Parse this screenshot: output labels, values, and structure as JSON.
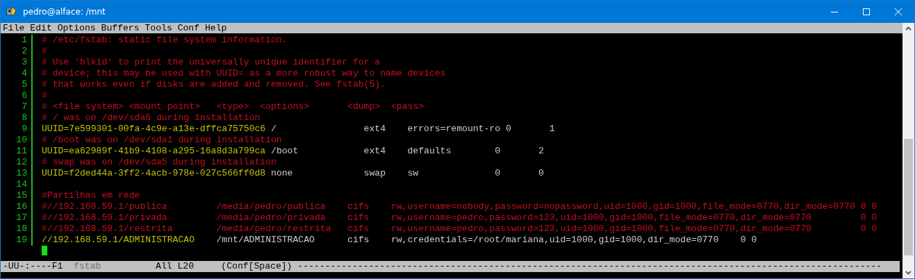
{
  "window": {
    "title": "pedro@alface: /mnt"
  },
  "menu": [
    "File",
    "Edit",
    "Options",
    "Buffers",
    "Tools",
    "Conf",
    "Help"
  ],
  "lines": [
    {
      "number": "1",
      "segments": [
        {
          "kind": "comment",
          "text": "# /etc/fstab: static file system information."
        }
      ]
    },
    {
      "number": "2",
      "segments": [
        {
          "kind": "comment",
          "text": "#"
        }
      ]
    },
    {
      "number": "3",
      "segments": [
        {
          "kind": "comment",
          "text": "# Use 'blkid' to print the universally unique identifier for a"
        }
      ]
    },
    {
      "number": "4",
      "segments": [
        {
          "kind": "comment",
          "text": "# device; this may be used with UUID= as a more robust way to name devices"
        }
      ]
    },
    {
      "number": "5",
      "segments": [
        {
          "kind": "comment",
          "text": "# that works even if disks are added and removed. See fstab(5)."
        }
      ]
    },
    {
      "number": "6",
      "segments": [
        {
          "kind": "comment",
          "text": "#"
        }
      ]
    },
    {
      "number": "7",
      "segments": [
        {
          "kind": "comment",
          "text": "# <file system> <mount point>   <type>  <options>       <dump>  <pass>"
        }
      ]
    },
    {
      "number": "8",
      "segments": [
        {
          "kind": "comment",
          "text": "# / was on /dev/sda6 during installation"
        }
      ]
    },
    {
      "number": "9",
      "segments": [
        {
          "kind": "device",
          "text": "UUID=7e599301-00fa-4c9e-a13e-dffca75750c6"
        },
        {
          "kind": "plain",
          "text": " /                ext4    errors=remount-ro 0       1"
        }
      ]
    },
    {
      "number": "10",
      "segments": [
        {
          "kind": "comment",
          "text": "# /boot was on /dev/sda1 during installation"
        }
      ]
    },
    {
      "number": "11",
      "segments": [
        {
          "kind": "device",
          "text": "UUID=ea62989f-41b9-4108-a295-16a8d3a799ca"
        },
        {
          "kind": "plain",
          "text": " /boot            ext4    defaults        0       2"
        }
      ]
    },
    {
      "number": "12",
      "segments": [
        {
          "kind": "comment",
          "text": "# swap was on /dev/sda5 during installation"
        }
      ]
    },
    {
      "number": "13",
      "segments": [
        {
          "kind": "device",
          "text": "UUID=f2ded44a-3ff2-4acb-978e-027c566ff0d8"
        },
        {
          "kind": "plain",
          "text": " none             swap    sw              0       0"
        }
      ]
    },
    {
      "number": "14"
    },
    {
      "number": "15",
      "segments": [
        {
          "kind": "comment",
          "text": "#Partilhas em rede"
        }
      ]
    },
    {
      "number": "16",
      "segments": [
        {
          "kind": "comment",
          "text": "#//192.168.59.1/publica         /media/pedro/publica    cifs    rw,username=nobody,password=nopassword,uid=1000,gid=1000,file_mode=0770,dir_mode=0770 0 0"
        }
      ]
    },
    {
      "number": "17",
      "segments": [
        {
          "kind": "comment",
          "text": "#//192.168.59.1/privada         /media/pedro/privada    cifs    rw,username=pedro,password=123,uid=1000,gid=1000,file_mode=0770,dir_mode=0770         0 0"
        }
      ]
    },
    {
      "number": "18",
      "segments": [
        {
          "kind": "comment",
          "text": "#//192.168.59.1/restrita        /media/pedro/restrita   cifs    rw,username=pedro,password=123,uid=1000,gid=1000,file_mode=0770,dir_mode=0770         0 0"
        }
      ]
    },
    {
      "number": "19",
      "segments": [
        {
          "kind": "device",
          "text": "//192.168.59.1/ADMINISTRACAO"
        },
        {
          "kind": "plain",
          "text": "    /mnt/ADMINISTRACAO      cifs    rw,credentials=/root/mariana,uid=1000,gid=1000,dir_mode=0770    0 0"
        }
      ]
    }
  ],
  "mode_line": [
    {
      "kind": "plain",
      "text": "-UU-:----F1  "
    },
    {
      "kind": "buffer",
      "text": "fstab"
    },
    {
      "kind": "plain",
      "text": "          All L20     (Conf[Space]) -----------------------------------------------------------------------------------------------------------"
    }
  ]
}
